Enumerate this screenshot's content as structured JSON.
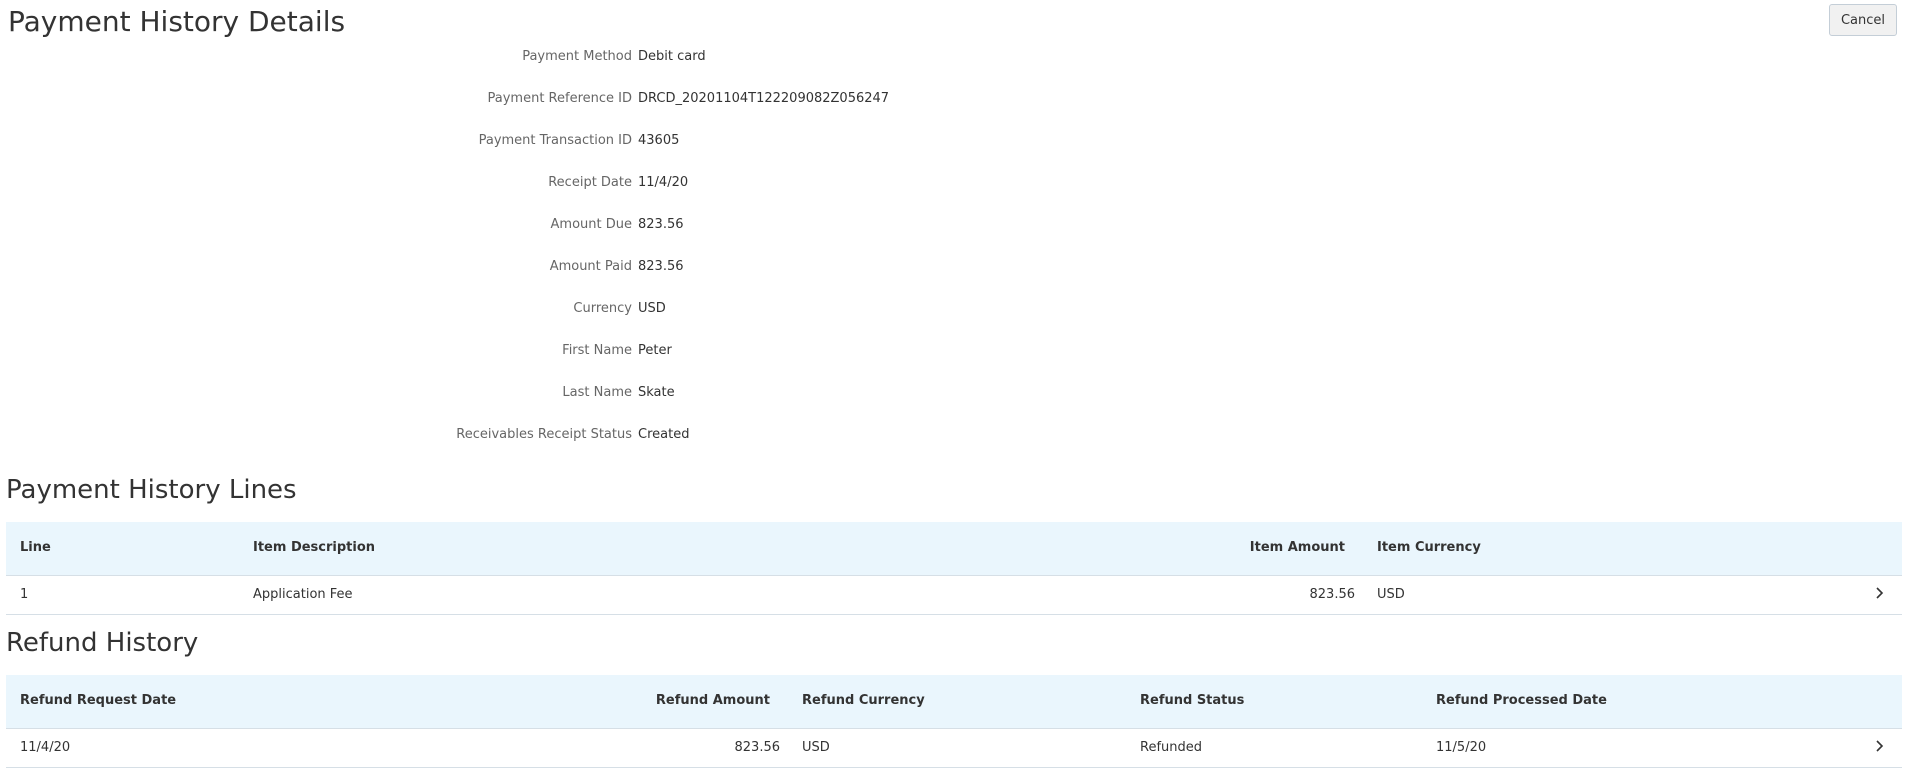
{
  "header": {
    "title": "Payment History Details",
    "cancel_label": "Cancel"
  },
  "details": {
    "fields": [
      {
        "label": "Payment Method",
        "value": "Debit card"
      },
      {
        "label": "Payment Reference ID",
        "value": "DRCD_20201104T122209082Z056247"
      },
      {
        "label": "Payment Transaction ID",
        "value": "43605"
      },
      {
        "label": "Receipt Date",
        "value": "11/4/20"
      },
      {
        "label": "Amount Due",
        "value": "823.56"
      },
      {
        "label": "Amount Paid",
        "value": "823.56"
      },
      {
        "label": "Currency",
        "value": "USD"
      },
      {
        "label": "First Name",
        "value": "Peter"
      },
      {
        "label": "Last Name",
        "value": "Skate"
      },
      {
        "label": "Receivables Receipt Status",
        "value": "Created"
      }
    ]
  },
  "lines": {
    "title": "Payment History Lines",
    "columns": {
      "line": "Line",
      "item_description": "Item Description",
      "item_amount": "Item Amount",
      "item_currency": "Item Currency"
    },
    "rows": [
      {
        "line": "1",
        "item_description": "Application Fee",
        "item_amount": "823.56",
        "item_currency": "USD"
      }
    ]
  },
  "refunds": {
    "title": "Refund History",
    "columns": {
      "request_date": "Refund Request Date",
      "amount": "Refund Amount",
      "currency": "Refund Currency",
      "status": "Refund Status",
      "processed_date": "Refund Processed Date"
    },
    "rows": [
      {
        "request_date": "11/4/20",
        "amount": "823.56",
        "currency": "USD",
        "status": "Refunded",
        "processed_date": "11/5/20"
      }
    ]
  }
}
